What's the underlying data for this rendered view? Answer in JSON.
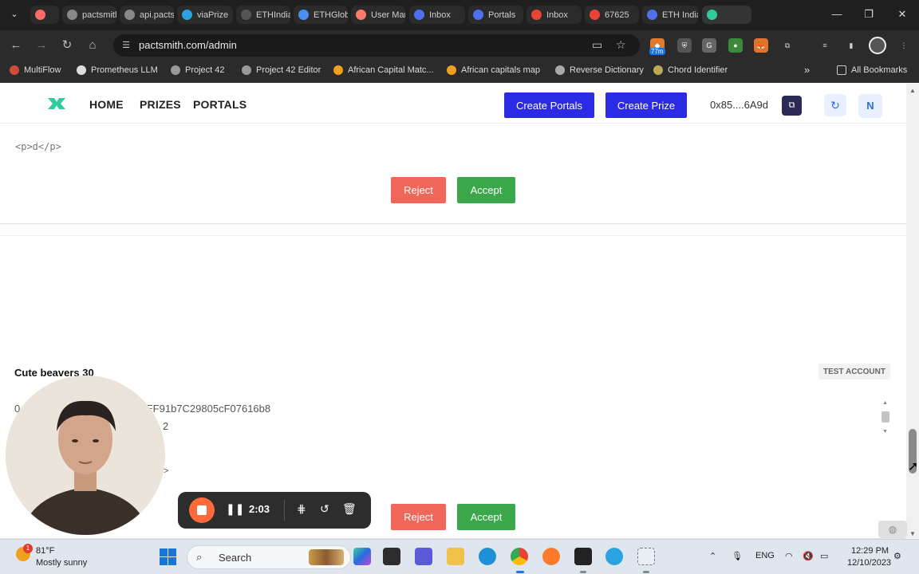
{
  "browser": {
    "tabs": [
      {
        "label": "",
        "icon": "record-icon",
        "color": "#ff6a6a"
      },
      {
        "label": "pactsmith",
        "icon": "globe-icon",
        "color": "#888888"
      },
      {
        "label": "api.pactsmith",
        "icon": "globe-icon",
        "color": "#888888"
      },
      {
        "label": "viaPrize",
        "icon": "telegram-icon",
        "color": "#2aa3e0"
      },
      {
        "label": "ETHIndia",
        "icon": "globe-icon",
        "color": "#555555"
      },
      {
        "label": "ETHGlobal",
        "icon": "chrome-icon",
        "color": "#4a8ef0"
      },
      {
        "label": "User Management",
        "icon": "app-icon",
        "color": "#ff7a6a"
      },
      {
        "label": "Inbox",
        "icon": "gear-icon",
        "color": "#4f6ff0"
      },
      {
        "label": "Portals",
        "icon": "gear-icon",
        "color": "#4f6ff0"
      },
      {
        "label": "Inbox",
        "icon": "gmail-icon",
        "color": "#ea4335"
      },
      {
        "label": "67625",
        "icon": "gmail-icon",
        "color": "#ea4335"
      },
      {
        "label": "ETH India",
        "icon": "gear-icon",
        "color": "#4f6ff0"
      },
      {
        "label": "",
        "icon": "pactsmith-icon",
        "color": "#2ecc9a"
      }
    ],
    "url": "pactsmith.com/admin",
    "extension_badge": "77m",
    "bookmarks": [
      {
        "label": "MultiFlow",
        "color": "#d24a3a"
      },
      {
        "label": "Prometheus LLM",
        "color": "#dddddd"
      },
      {
        "label": "Project 42",
        "color": "#999999"
      },
      {
        "label": "Project 42 Editor",
        "color": "#999999"
      },
      {
        "label": "African Capital Matc...",
        "color": "#f0a020"
      },
      {
        "label": "African capitals map",
        "color": "#f0a020"
      },
      {
        "label": "Reverse Dictionary",
        "color": "#aaaaaa"
      },
      {
        "label": "Chord Identifier",
        "color": "#bbaa55"
      }
    ],
    "all_bookmarks": "All Bookmarks"
  },
  "site": {
    "nav": [
      "HOME",
      "PRIZES",
      "PORTALS"
    ],
    "create_portals": "Create Portals",
    "create_prize": "Create Prize",
    "wallet": "0x85....6A9d",
    "avatar_initial": "N",
    "brand_color": "#2b2be6"
  },
  "cards": [
    {
      "code": "<p>d</p>",
      "reject": "Reject",
      "accept": "Accept"
    },
    {
      "title": "Cute beavers 30",
      "badge": "TEST ACCOUNT",
      "line1_visible": "0",
      "line1_tail": "EF91b7C29805cF07616b8",
      "line2_tail": "2",
      "line3_tail": ">",
      "reject": "Reject",
      "accept": "Accept"
    }
  ],
  "recorder": {
    "time": "2:03"
  },
  "taskbar": {
    "weather_temp": "81°F",
    "weather_desc": "Mostly sunny",
    "weather_badge": "1",
    "search": "Search",
    "lang": "ENG",
    "time": "12:29 PM",
    "date": "12/10/2023"
  }
}
